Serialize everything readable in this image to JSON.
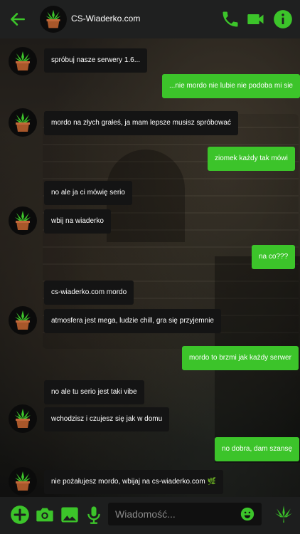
{
  "theme": {
    "accent": "#3cc42a",
    "incoming_bg": "#141414",
    "outgoing_bg": "#3cc42a",
    "header_bg": "#1f2020"
  },
  "header": {
    "title": "CS-Wiaderko.com",
    "icons": [
      "back-arrow-icon",
      "phone-icon",
      "video-camera-icon",
      "info-icon"
    ]
  },
  "messages": [
    {
      "dir": "in",
      "text": "spróbuj nasze serwery 1.6..."
    },
    {
      "dir": "out",
      "text": "...nie mordo nie lubie nie podoba mi sie"
    },
    {
      "dir": "in",
      "text": "mordo na złych grałeś, ja mam lepsze musisz spróbować"
    },
    {
      "dir": "out",
      "text": "ziomek każdy tak mówi"
    },
    {
      "dir": "in",
      "text": "no ale ja ci mówię serio"
    },
    {
      "dir": "in",
      "text": "wbij na wiaderko"
    },
    {
      "dir": "out",
      "text": "na co???"
    },
    {
      "dir": "in",
      "text": "cs-wiaderko.com mordo"
    },
    {
      "dir": "in",
      "text": "atmosfera jest mega, ludzie chill, gra się przyjemnie"
    },
    {
      "dir": "out",
      "text": "mordo to brzmi jak każdy serwer"
    },
    {
      "dir": "in",
      "text": "no ale tu serio jest taki vibe"
    },
    {
      "dir": "in",
      "text": "wchodzisz i czujesz się jak w domu"
    },
    {
      "dir": "out",
      "text": "no dobra, dam szansę"
    },
    {
      "dir": "in",
      "text": "nie pożałujesz mordo, wbijaj na cs-wiaderko.com 🌿"
    }
  ],
  "composer": {
    "placeholder": "Wiadomość...",
    "icons": [
      "add-icon",
      "camera-icon",
      "gallery-icon",
      "microphone-icon",
      "emoji-icon",
      "leaf-icon"
    ]
  }
}
